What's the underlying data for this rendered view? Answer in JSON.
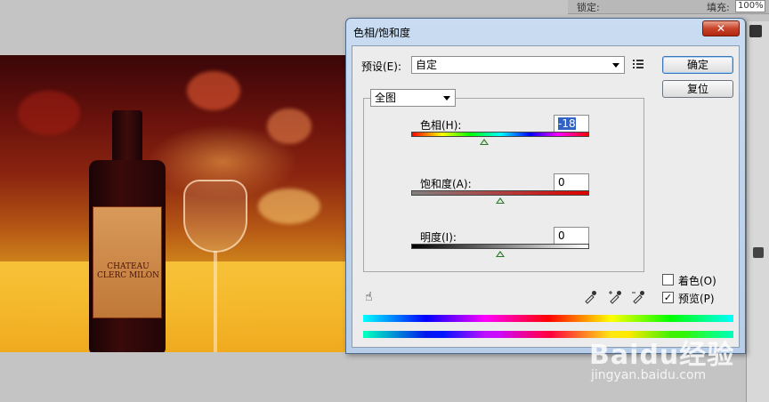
{
  "toolbar": {
    "lock_label": "锁定:",
    "fill_label": "填充:",
    "fill_value": "100%"
  },
  "photo": {
    "label_text": "CHATEAU CLERC MILON"
  },
  "dialog": {
    "title": "色相/饱和度",
    "close_glyph": "✕",
    "preset_label": "预设(E):",
    "preset_value": "自定",
    "preset_menu_icon": "list-options-icon",
    "ok_label": "确定",
    "reset_label": "复位",
    "channel_value": "全图",
    "hue_label": "色相(H):",
    "hue_value": "-18",
    "saturation_label": "饱和度(A):",
    "saturation_value": "0",
    "lightness_label": "明度(I):",
    "lightness_value": "0",
    "hue_slider_fraction": 0.41,
    "saturation_slider_fraction": 0.5,
    "lightness_slider_fraction": 0.5,
    "colorize_label": "着色(O)",
    "colorize_checked": false,
    "preview_label": "预览(P)",
    "preview_checked": true,
    "hand_tool_icon": "target-adjust-hand-icon",
    "eyedropper_icons": [
      "eyedropper-icon",
      "eyedropper-plus-icon",
      "eyedropper-minus-icon"
    ]
  },
  "watermark": {
    "logo": "Baidu经验",
    "url": "jingyan.baidu.com"
  }
}
